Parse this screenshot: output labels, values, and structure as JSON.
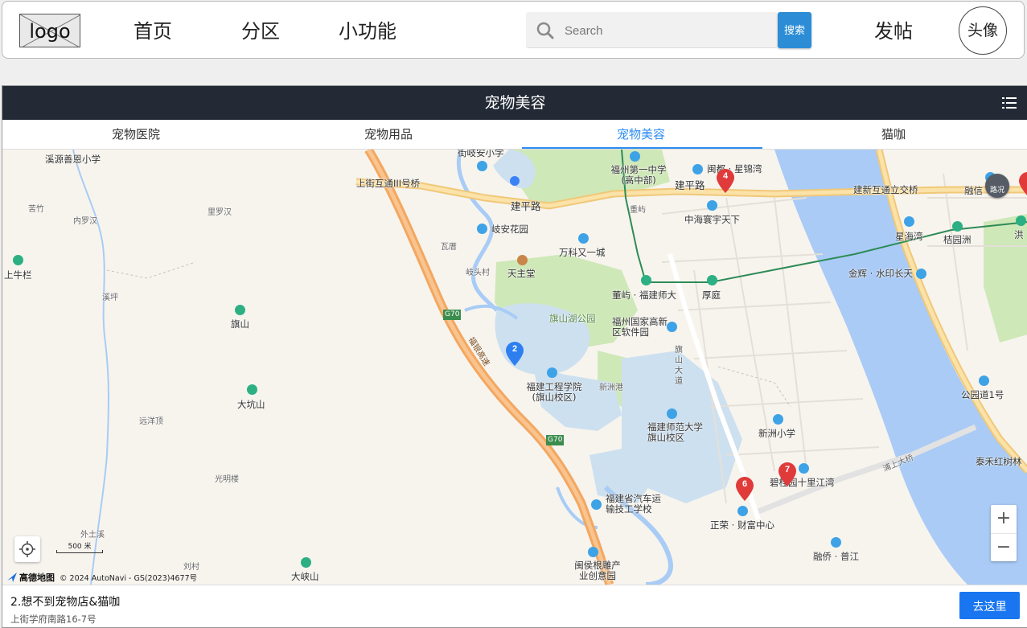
{
  "navbar": {
    "logo": "logo",
    "links": [
      "首页",
      "分区",
      "小功能"
    ],
    "search_placeholder": "Search",
    "search_button": "搜索",
    "post": "发帖",
    "avatar": "头像"
  },
  "app": {
    "title": "宠物美容",
    "tabs": [
      {
        "label": "宠物医院",
        "active": false
      },
      {
        "label": "宠物用品",
        "active": false
      },
      {
        "label": "宠物美容",
        "active": true
      },
      {
        "label": "猫咖",
        "active": false
      }
    ]
  },
  "map": {
    "labels": {
      "xiyuan_school": "溪源善恩小学",
      "kuzhu": "苦竹",
      "neiluohan": "内罗汉",
      "liluohan": "里罗汉",
      "shangniulan": "上牛栏",
      "xiping": "溪坪",
      "qishan": "旗山",
      "dakengshan": "大坑山",
      "yuanyangding": "远洋顶",
      "guangminglou": "光明楼",
      "waitu": "外土溪",
      "liucun": "刘村",
      "daxiashan": "大峡山",
      "shangjie_bridge": "上街互通III号桥",
      "qian_school": "街岐安小学",
      "jianping_road": "建平路",
      "jianping_road2": "建平路",
      "qianhuayuan": "岐安花园",
      "wacuo": "瓦厝",
      "qitoucun": "岐头村",
      "tianzhutang": "天主堂",
      "wanke": "万科又一城",
      "fuzhou_no1": "福州第一中学(高中部)",
      "mindu": "闽都 · 星锦湾",
      "chongshan": "重屿",
      "zhonghai": "中海寰宇天下",
      "jianxin_bridge": "建新互通立交桥",
      "rongxin": "融信",
      "luzhuang": "路况",
      "xinghaiwan": "星海湾",
      "guiyuanzhou": "桔园洲",
      "hongshan": "洪",
      "jinhui": "金辉 · 水印长天",
      "dongyu": "董屿 · 福建师大",
      "houting": "厚庭",
      "qishan_park": "旗山湖公园",
      "hightech": "福州国家高新区软件园",
      "fjeu": "福建工程学院(旗山校区)",
      "xinzhougang": "新洲港",
      "qishan_ave": "旗山大道",
      "fjnu": "福建师范大学旗山校区",
      "xinzhou_school": "新洲小学",
      "park1": "公园道1号",
      "taihe": "泰禾红树林",
      "shanbridge": "浦上大桥",
      "biguiyuan": "碧桂园十里江湾",
      "auto_school": "福建省汽车运输技工学校",
      "zhengrong": "正荣 · 财富中心",
      "rongqiao": "融侨 · 普江",
      "minhou": "闽侯根雕产业创意园",
      "g70": "G70",
      "g70b": "G70",
      "fuyin": "福银高速"
    },
    "pins": [
      {
        "label": "4",
        "color": "#e03a3a"
      },
      {
        "label": "2",
        "color": "#2d7ff0"
      },
      {
        "label": "7",
        "color": "#e03a3a"
      },
      {
        "label": "6",
        "color": "#e03a3a"
      }
    ],
    "scale": "500 米",
    "provider": "高德地图",
    "copyright": "© 2024 AutoNavi - GS(2023)4677号",
    "zoom_in": "+",
    "zoom_out": "−"
  },
  "result": {
    "name": "2.想不到宠物店&猫咖",
    "address": "上街学府南路16-7号",
    "go_button": "去这里"
  }
}
